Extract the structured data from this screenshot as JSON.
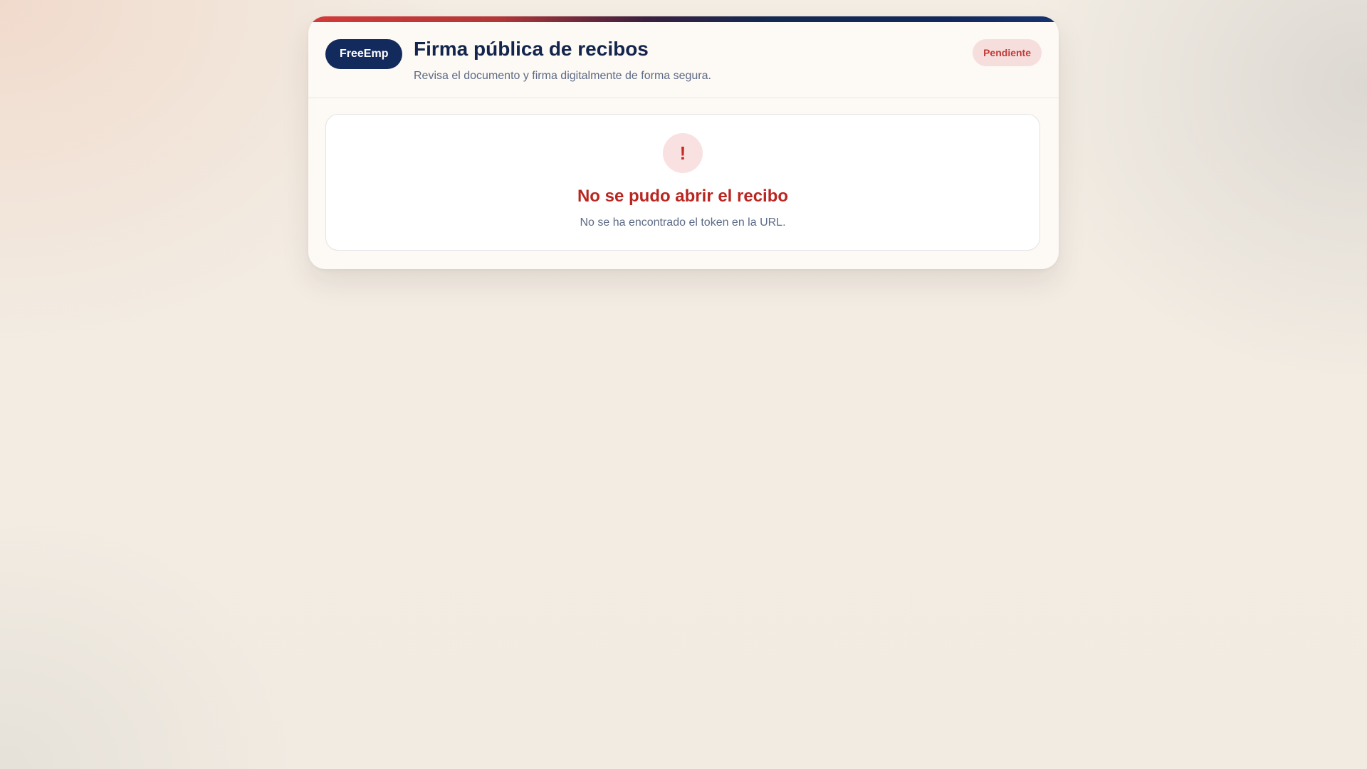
{
  "header": {
    "brand": "FreeEmp",
    "title": "Firma pública de recibos",
    "subtitle": "Revisa el documento y firma digitalmente de forma segura.",
    "status": "Pendiente"
  },
  "error": {
    "icon": "!",
    "icon_name": "exclamation-icon",
    "title": "No se pudo abrir el recibo",
    "message": "No se ha encontrado el token en la URL."
  },
  "colors": {
    "brand": "#132a5c",
    "title": "#13254d",
    "error": "#b92621",
    "status_bg": "#f6dedd",
    "status_text": "#c23a36",
    "accent_start": "#d23a3a",
    "accent_end": "#17336e"
  }
}
